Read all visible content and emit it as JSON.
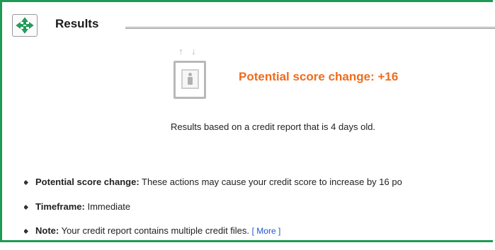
{
  "header": {
    "title": "Results",
    "icon": "recycle-arrows-icon"
  },
  "result": {
    "score_change_text": "Potential score change: +16",
    "score_change_color": "#f06b1c",
    "based_on_text": "Results based on a credit report that is 4 days old.",
    "arrows_text": "↑ ↓"
  },
  "details": [
    {
      "label": "Potential score change:",
      "text": " These actions may cause your credit score to increase by 16 po"
    },
    {
      "label": "Timeframe:",
      "text": " Immediate"
    },
    {
      "label": "Note:",
      "text": " Your credit report contains multiple credit files. ",
      "link": "[ More ]"
    }
  ],
  "colors": {
    "frame_border": "#1f9a55",
    "accent_orange": "#f06b1c",
    "link_blue": "#2255cc"
  }
}
